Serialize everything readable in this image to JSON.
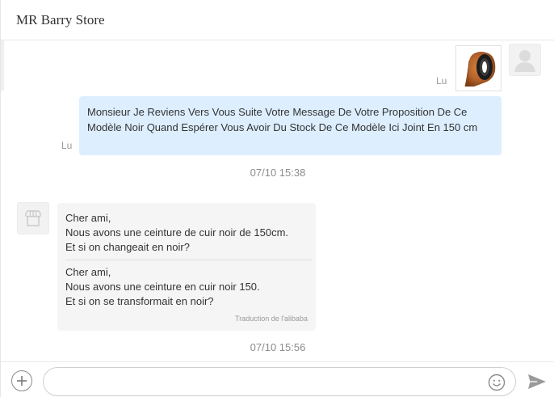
{
  "header": {
    "title": "MR Barry Store"
  },
  "messages": {
    "image_message": {
      "read_status": "Lu",
      "thumbnail_icon": "brown-leather-belt-coil-image"
    },
    "text_message": {
      "read_status": "Lu",
      "text": "Monsieur Je Reviens Vers Vous Suite Votre Message De Votre Proposition De Ce Modèle Noir Quand Espérer Vous Avoir Du Stock De Ce Modèle Ici Joint En 150 cm"
    },
    "timestamp_1": "07/10 15:38",
    "reply_message": {
      "original_lines": [
        "Cher ami,",
        "Nous avons une ceinture de cuir noir de 150cm.",
        "Et si on changeait en noir?"
      ],
      "translated_lines": [
        "Cher ami,",
        "Nous avons une ceinture en cuir noir 150.",
        "Et si on se transformait en noir?"
      ],
      "translation_credit": "Traduction de l'alibaba",
      "avatar_icon": "store-icon"
    },
    "timestamp_2": "07/10 15:56"
  },
  "composer": {
    "input_value": "",
    "input_placeholder": "",
    "add_icon": "plus-icon",
    "emoji_icon": "smiley-icon",
    "send_icon": "send-icon"
  },
  "colors": {
    "outgoing_bubble": "#ddeeff",
    "incoming_bubble": "#f5f5f5",
    "timestamp": "#8c8c8c",
    "read_status": "#9a9a9a"
  }
}
